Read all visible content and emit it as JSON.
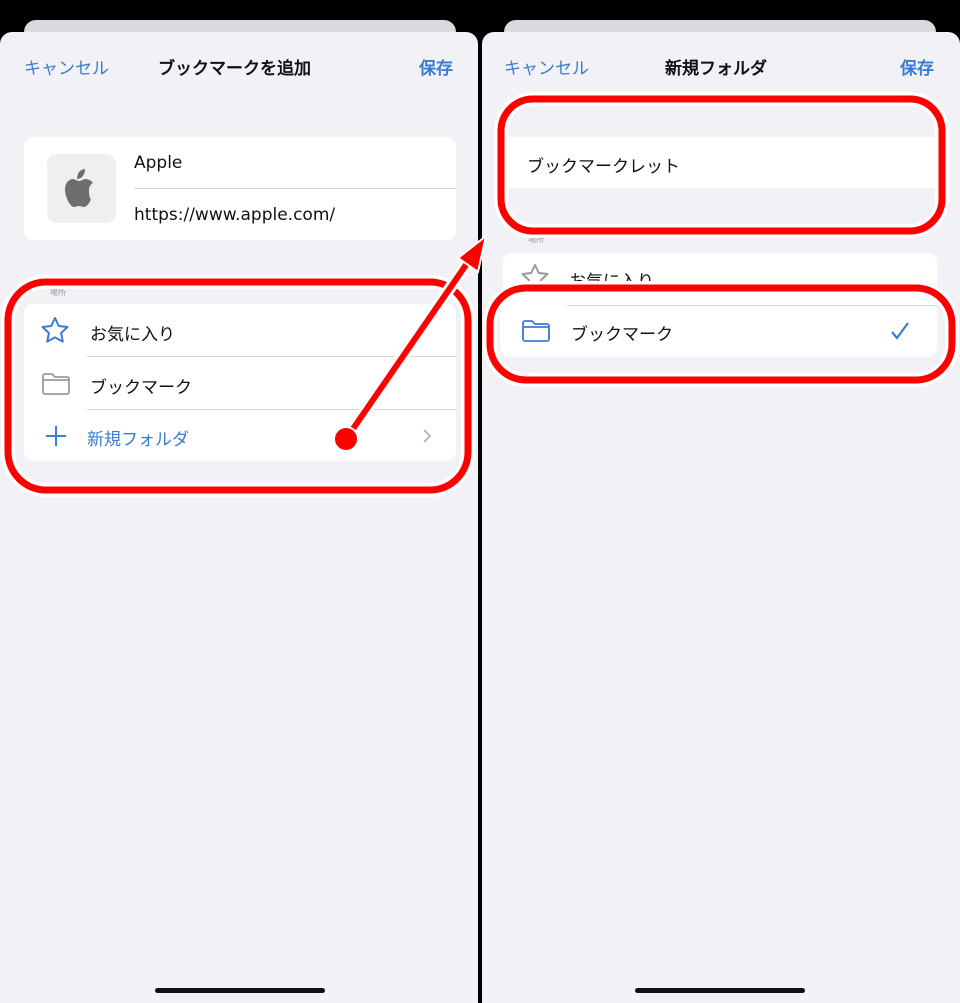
{
  "left": {
    "cancel": "キャンセル",
    "title": "ブックマークを追加",
    "save": "保存",
    "bookmark_title": "Apple",
    "bookmark_url": "https://www.apple.com/",
    "section_label": "場所",
    "items": [
      {
        "label": "お気に入り",
        "icon": "star-icon"
      },
      {
        "label": "ブックマーク",
        "icon": "folder-icon"
      },
      {
        "label": "新規フォルダ",
        "icon": "plus-icon"
      }
    ]
  },
  "right": {
    "cancel": "キャンセル",
    "title": "新規フォルダ",
    "save": "保存",
    "folder_name": "ブックマークレット",
    "section_label": "場所",
    "items": [
      {
        "label": "お気に入り",
        "icon": "star-icon"
      },
      {
        "label": "ブックマーク",
        "icon": "folder-icon",
        "selected": true
      }
    ]
  },
  "colors": {
    "accent": "#3a7bd5",
    "annotation": "#ff0000"
  }
}
